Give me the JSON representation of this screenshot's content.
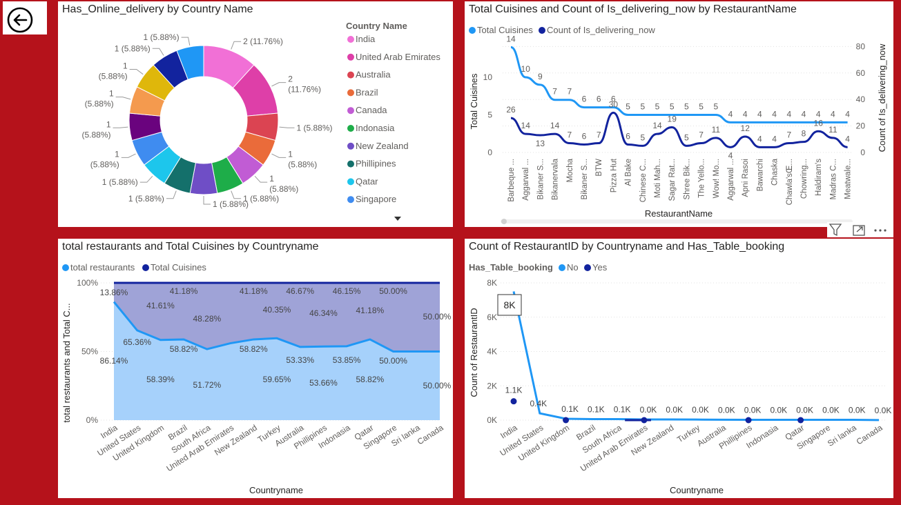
{
  "colors": {
    "background": "#b5121b",
    "light_blue": "#1f97f5",
    "dark_blue": "#12239e",
    "area_light": "#a6d1fb",
    "area_dark": "#9fa3d7"
  },
  "nav": {
    "back_icon": "back-arrow-circle-icon"
  },
  "panels": {
    "p1": {
      "title": "Has_Online_delivery by Country Name",
      "legend_title": "Country Name"
    },
    "p2": {
      "title": "Total Cuisines and Count of Is_delivering_now by RestaurantName",
      "xlabel": "RestaurantName",
      "ylabel_left": "Total Cuisines",
      "ylabel_right": "Count of Is_delivering_now",
      "legend": [
        "Total Cuisines",
        "Count of Is_delivering_now"
      ]
    },
    "p3": {
      "title": "total restaurants and Total Cuisines by Countryname",
      "xlabel": "Countryname",
      "ylabel": "total restaurants and Total C...",
      "legend": [
        "total restaurants",
        "Total Cuisines"
      ]
    },
    "p4": {
      "title": "Count of RestaurantID by Countryname and Has_Table_booking",
      "xlabel": "Countryname",
      "ylabel": "Count of RestaurantID",
      "legend_title": "Has_Table_booking",
      "legend": [
        "No",
        "Yes"
      ],
      "tooltip": "8K"
    }
  },
  "toolbar": {
    "icons": [
      "filter-icon",
      "focus-mode-icon",
      "more-options-icon"
    ]
  },
  "chart_data": [
    {
      "type": "pie",
      "title": "Has_Online_delivery by Country Name",
      "legend_title": "Country Name",
      "categories": [
        "India",
        "United Arab Emirates",
        "Australia",
        "Brazil",
        "Canada",
        "Indonasia",
        "New Zealand",
        "Phillipines",
        "Qatar",
        "Singapore",
        "",
        "",
        "",
        "",
        ""
      ],
      "legend_entries": [
        "India",
        "United Arab Emirates",
        "Australia",
        "Brazil",
        "Canada",
        "Indonasia",
        "New Zealand",
        "Phillipines",
        "Qatar",
        "Singapore"
      ],
      "values": [
        2,
        2,
        1,
        1,
        1,
        1,
        1,
        1,
        1,
        1,
        1,
        1,
        1,
        1,
        1
      ],
      "labels": [
        "2 (11.76%)",
        "2 (11.76%)",
        "1 (5.88%)",
        "1 (5.88%)",
        "1 (5.88%)",
        "1 (5.88%)",
        "1 (5.88%)",
        "1 (5.88%)",
        "1 (5.88%)",
        "1 (5.88%)",
        "1 (5.88%)",
        "1 (5.88%)",
        "1 (5.88%)",
        "1 (5.88%)",
        "1 (5.88%)"
      ],
      "colors": [
        "#f170d6",
        "#de3fa8",
        "#db4452",
        "#ea6b3a",
        "#c15cd4",
        "#1ead49",
        "#6f4ec6",
        "#14706b",
        "#1dc6ec",
        "#3f8cf0",
        "#6a037e",
        "#f49a4e",
        "#dfb70b",
        "#12239e",
        "#1f97f5"
      ]
    },
    {
      "type": "line",
      "title": "Total Cuisines and Count of Is_delivering_now by RestaurantName",
      "categories": [
        "Barbeque ...",
        "Aggarwal ...",
        "Bikaner S...",
        "Bikanervala",
        "Mocha",
        "Bikaner S...",
        "BTW",
        "Pizza Hut",
        "Al Bake",
        "Chinese C...",
        "Moti Mah...",
        "Sagar Rat...",
        "Shree Bik...",
        "The Yello...",
        "Wow! Mo...",
        "Aggarwal ...",
        "Apni Rasoi",
        "Bawarchi",
        "Chaska",
        "Chawla'sŒ...",
        "Chowring...",
        "Haldiram's",
        "Madras C...",
        "Meatwale..."
      ],
      "series": [
        {
          "name": "Total Cuisines",
          "axis": "left",
          "values": [
            14,
            10,
            9,
            7,
            7,
            6,
            6,
            6,
            5,
            5,
            5,
            5,
            5,
            5,
            5,
            4,
            4,
            4,
            4,
            4,
            4,
            4,
            4,
            4
          ]
        },
        {
          "name": "Count of Is_delivering_now",
          "axis": "right",
          "values": [
            26,
            14,
            13,
            14,
            7,
            6,
            7,
            30,
            6,
            5,
            14,
            19,
            5,
            7,
            11,
            4,
            12,
            4,
            4,
            7,
            8,
            16,
            11,
            4
          ]
        }
      ],
      "y_left": {
        "label": "Total Cuisines",
        "range": [
          0,
          14
        ],
        "ticks": [
          0,
          5,
          10
        ]
      },
      "y_right": {
        "label": "Count of Is_delivering_now",
        "range": [
          0,
          80
        ],
        "ticks": [
          0,
          20,
          40,
          60,
          80
        ]
      },
      "xlabel": "RestaurantName"
    },
    {
      "type": "area",
      "stacked": "100%",
      "title": "total restaurants and Total Cuisines by Countryname",
      "categories": [
        "India",
        "United States",
        "United Kingdom",
        "Brazil",
        "South Africa",
        "United Arab Emirates",
        "New Zealand",
        "Turkey",
        "Australia",
        "Phillipines",
        "Indonasia",
        "Qatar",
        "Singapore",
        "Sri lanka",
        "Canada"
      ],
      "series": [
        {
          "name": "total restaurants",
          "values": [
            86.14,
            65.36,
            58.39,
            58.82,
            51.72,
            56.0,
            58.82,
            59.65,
            53.33,
            53.66,
            53.85,
            58.82,
            50.0,
            50.0,
            50.0
          ]
        },
        {
          "name": "Total Cuisines",
          "values": [
            13.86,
            34.64,
            41.61,
            41.18,
            48.28,
            44.0,
            41.18,
            40.35,
            46.67,
            46.34,
            46.15,
            41.18,
            50.0,
            50.0,
            50.0
          ]
        }
      ],
      "labels_top": [
        "13.86%",
        "41.61%",
        "41.18%",
        "48.28%",
        "41.18%",
        "40.35%",
        "46.67%",
        "46.34%",
        "46.15%",
        "41.18%",
        "50.00%",
        "50.00%"
      ],
      "labels_bottom": [
        "86.14%",
        "65.36%",
        "58.39%",
        "58.82%",
        "51.72%",
        "58.82%",
        "59.65%",
        "53.33%",
        "53.66%",
        "53.85%",
        "58.82%",
        "50.00%",
        "50.00%"
      ],
      "y_ticks": [
        "0%",
        "50%",
        "100%"
      ],
      "xlabel": "Countryname",
      "ylabel": "total restaurants and Total C..."
    },
    {
      "type": "line",
      "title": "Count of RestaurantID by Countryname and Has_Table_booking",
      "categories": [
        "India",
        "United States",
        "United Kingdom",
        "Brazil",
        "South Africa",
        "United Arab Emirates",
        "New Zealand",
        "Turkey",
        "Australia",
        "Phillipines",
        "Indonasia",
        "Qatar",
        "Singapore",
        "Sri lanka",
        "Canada"
      ],
      "series": [
        {
          "name": "No",
          "values": [
            7500,
            400,
            80,
            60,
            60,
            40,
            40,
            34,
            24,
            18,
            21,
            18,
            20,
            20,
            4
          ]
        },
        {
          "name": "Yes",
          "values": [
            1100,
            null,
            0,
            null,
            null,
            0,
            null,
            null,
            null,
            0,
            null,
            0,
            null,
            null,
            null
          ]
        }
      ],
      "data_labels": [
        "8K",
        "0.4K",
        "0.1K",
        "0.1K",
        "0.1K",
        "0.0K",
        "0.0K",
        "0.0K",
        "0.0K",
        "0.0K",
        "0.0K",
        "0.0K",
        "0.0K",
        "0.0K",
        "0.0K"
      ],
      "yes_label": "1.1K",
      "y_ticks": [
        "0K",
        "2K",
        "4K",
        "6K",
        "8K"
      ],
      "ylim": [
        0,
        8000
      ],
      "xlabel": "Countryname",
      "ylabel": "Count of RestaurantID",
      "legend_title": "Has_Table_booking"
    }
  ]
}
